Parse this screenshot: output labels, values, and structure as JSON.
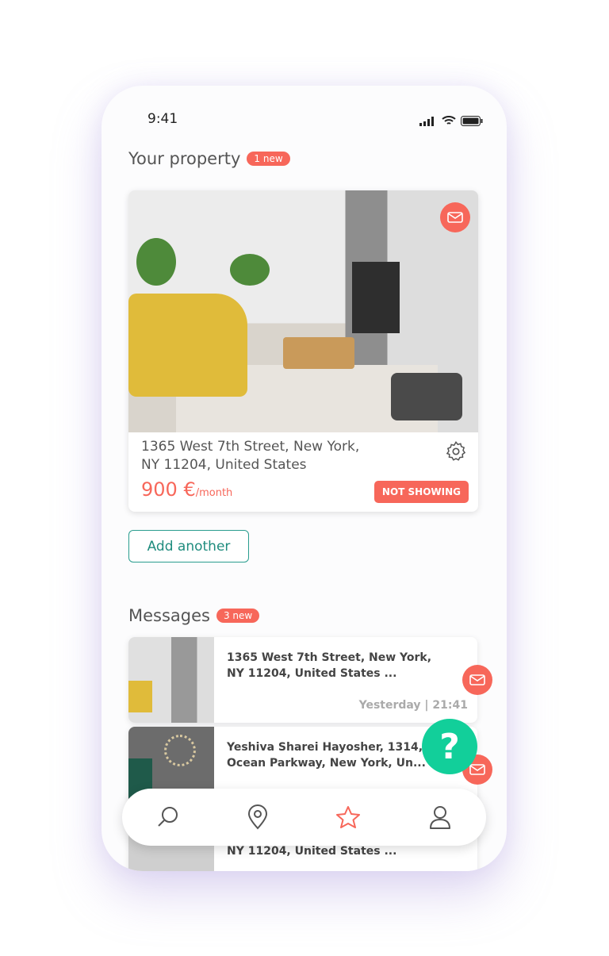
{
  "status_bar": {
    "time": "9:41"
  },
  "property_section": {
    "title": "Your property",
    "badge": "1 new",
    "card": {
      "address_line1": "1365 West 7th Street, New  York,",
      "address_line2": "NY 11204, United States",
      "price": "900 €",
      "price_unit": "/month",
      "status": "NOT SHOWING"
    },
    "add_button": "Add another"
  },
  "messages_section": {
    "title": "Messages",
    "badge": "3 new",
    "items": [
      {
        "line1": "1365 West 7th Street, New  York,",
        "line2": "NY 11204, United States ...",
        "time": "Yesterday | 21:41"
      },
      {
        "line1": "Yeshiva Sharei Hayosher, 1314,",
        "line2": "Ocean Parkway, New York, Un..."
      },
      {
        "line2": "NY 11204, United States ..."
      }
    ]
  },
  "help_button": "?",
  "nav": {
    "items": [
      "search-icon",
      "location-icon",
      "star-icon",
      "user-icon"
    ],
    "active": "star-icon"
  },
  "colors": {
    "accent": "#f7675a",
    "teal": "#2a9d8f",
    "help": "#12cf9a"
  }
}
